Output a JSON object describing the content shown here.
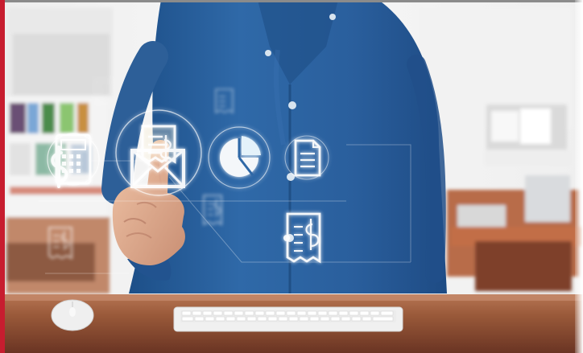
{
  "image": {
    "kind": "stock-photo",
    "accent_colors": {
      "left_accent": "#c71d2f",
      "shirt": "#2b5f9d",
      "hologram": "#dff6ff",
      "desk": "#9a5a3a"
    },
    "icons": [
      "calculator-dollar-icon",
      "receipt-envelope-icon",
      "pie-chart-icon",
      "document-icon",
      "receipt-dollar-icon"
    ]
  }
}
